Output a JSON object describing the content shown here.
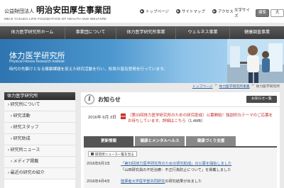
{
  "header": {
    "logo_corp": "公益財団法人",
    "logo_name": "明治安田厚生事業団",
    "logo_en": "MEIJI YASUDA LIFE FOUNDATION OF HEALTH AND WELFARE",
    "top_links": [
      "トップページ",
      "サイトマップ",
      "アクセス"
    ],
    "font_size_label": "文字サイズ",
    "font_size_options": [
      "標準",
      "大"
    ],
    "font_size_selected": "標準"
  },
  "nav": {
    "items": [
      "体力医学研究所ホーム",
      "事業団について",
      "体力医学研究所事業",
      "ウェルネス事業",
      "健康調査事業"
    ]
  },
  "hero": {
    "title": "体力医学研究所",
    "subtitle": "Physical Fitness Research Institute",
    "description": "時代の先駆けとなる健康課題を捉えた研究活動を行い、知見の普及啓発を行っています。"
  },
  "breadcrumb": {
    "items": [
      "トップページ",
      "体力医学研究所事業",
      "体力医学研究所"
    ],
    "separator": ">"
  },
  "sidebar": {
    "heading": "体力医学研究所",
    "items": [
      "研究所について",
      "研究活動",
      "研究スタッフ",
      "研究助成",
      "研究所ニュース",
      "メディア掲載",
      "最近の研究の紹介"
    ]
  },
  "news": {
    "title": "お知らせ",
    "list_button": "お知らせ一覧",
    "featured": {
      "date": "2016年 6月 3日",
      "text": "（第33回体力医学研究所のための研究助成）公募開始！独創的なテーマのご応募をお待ちしています。詳細はこちら",
      "size": "（1.4MB）",
      "icon": "pdf-icon"
    },
    "tabs": [
      "更新情報",
      "健康とメンタルヘルス",
      "健康づくり支援"
    ],
    "active_tab": "更新情報",
    "filter_button": "研究所ニュース一覧を見る",
    "rows": [
      {
        "date": "2016年6月1日",
        "link": "「第33回体力医学研究所のための研究助成」の公募を開始しました",
        "sub_link": "「山田研究員の不妊治療：不正行為防止について」",
        "sub_tail": "を掲載しました"
      },
      {
        "date": "2016年4月4日",
        "link": "陸軍者大学医学部共同研究",
        "tail": "の研究結果が出ました"
      }
    ]
  },
  "colors": {
    "nav_bg": "#4a4a4a",
    "hero_start": "#2d74b0",
    "hero_end": "#b9dbf2",
    "featured_text": "#c0302c",
    "link": "#2d5f99"
  }
}
